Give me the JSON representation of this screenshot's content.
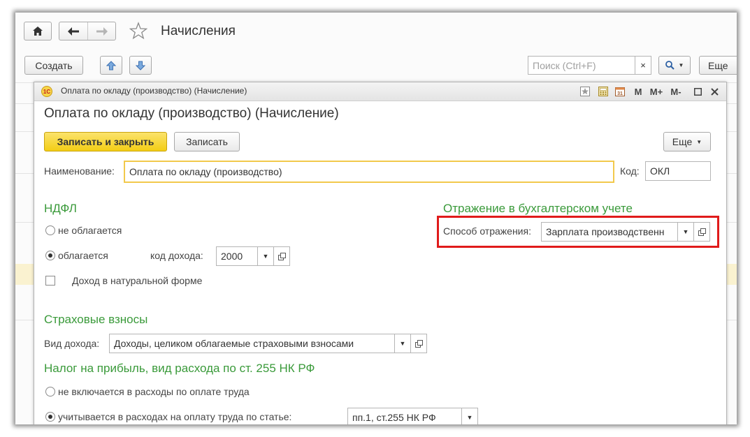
{
  "window": {
    "title": "Начисления",
    "toolbar": {
      "create_label": "Создать",
      "search_placeholder": "Поиск (Ctrl+F)",
      "search_clear": "×",
      "more_label": "Еще"
    }
  },
  "form": {
    "titlebar_text": "Оплата по окладу (производство) (Начисление)",
    "logo_text": "1С",
    "title": "Оплата по окладу (производство) (Начисление)",
    "save_close_label": "Записать и закрыть",
    "save_label": "Записать",
    "more_label": "Еще",
    "name_label": "Наименование:",
    "name_value": "Оплата по окладу (производство)",
    "code_label": "Код:",
    "code_value": "ОКЛ",
    "ndfl": {
      "heading": "НДФЛ",
      "not_taxed": "не облагается",
      "taxed": "облагается",
      "income_code_label": "код дохода:",
      "income_code_value": "2000",
      "natural_label": "Доход в натуральной форме"
    },
    "accounting": {
      "heading": "Отражение в бухгалтерском учете",
      "method_label": "Способ отражения:",
      "method_value": "Зарплата производственн"
    },
    "insurance": {
      "heading": "Страховые взносы",
      "income_type_label": "Вид дохода:",
      "income_type_value": "Доходы, целиком облагаемые страховыми взносами"
    },
    "profit_tax": {
      "heading": "Налог на прибыль, вид расхода по ст. 255 НК РФ",
      "not_included": "не включается в расходы по оплате труда",
      "included": "учитывается в расходах на оплату труда по статье:",
      "article_value": "пп.1, ст.255 НК РФ"
    }
  },
  "colors": {
    "accent_yellow": "#f5d21e",
    "heading_green": "#3a9a3a",
    "highlight_red": "#e01b1b"
  }
}
